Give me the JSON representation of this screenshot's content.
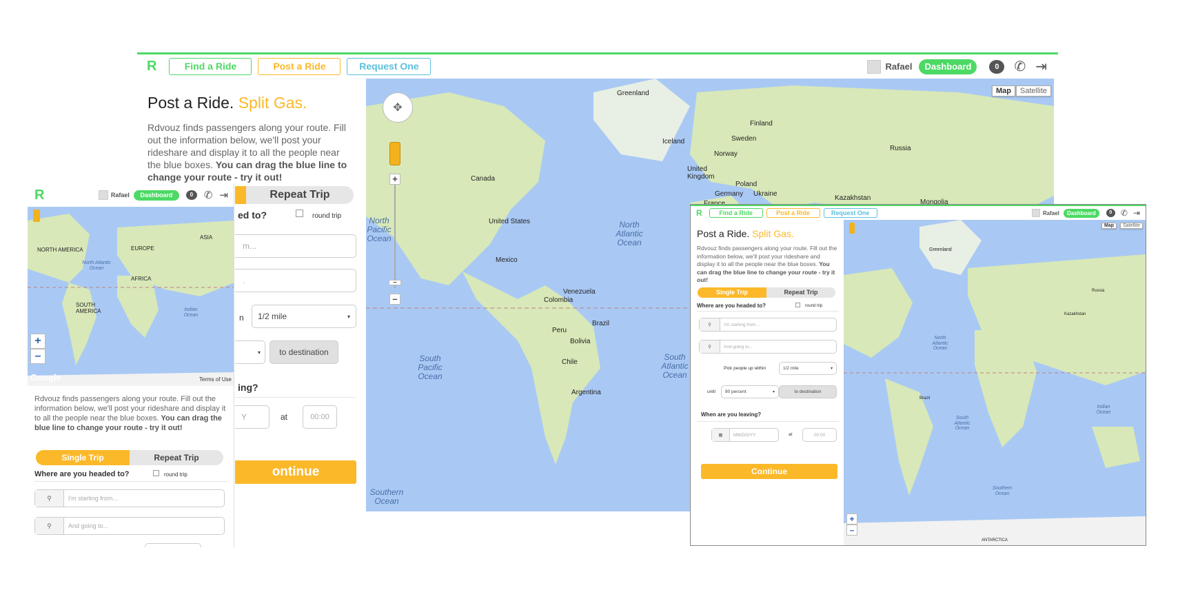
{
  "brand": {
    "logo": "R"
  },
  "nav": {
    "find_ride": "Find a Ride",
    "post_ride": "Post a Ride",
    "request_one": "Request One",
    "user_name": "Rafael",
    "dashboard": "Dashboard",
    "messages_count": "0"
  },
  "hero": {
    "title_main": "Post a Ride.",
    "title_accent": "Split Gas.",
    "description": "Rdvouz finds passengers along your route. Fill out the information below, we'll post your rideshare and display it to all the people near the blue boxes.",
    "description_bold": "You can drag the blue line to change your route - try it out!"
  },
  "trip_toggle": {
    "single": "Single Trip",
    "repeat": "Repeat Trip"
  },
  "form": {
    "headed_label": "Where are you headed to?",
    "round_trip": "round trip",
    "start_placeholder": "I'm starting from...",
    "dest_placeholder": "And going to...",
    "pickup_label": "Pick people up within",
    "pickup_value": "1/2 mile",
    "until_label": "until",
    "until_value": "80 percent",
    "to_destination": "to destination",
    "leaving_label": "When are you leaving?",
    "date_placeholder": "MM/DD/YY",
    "at_label": "at",
    "time_placeholder": "00:00",
    "continue": "Continue"
  },
  "map": {
    "type_map": "Map",
    "type_satellite": "Satellite",
    "google": "Google",
    "terms": "Terms of Use",
    "labels": {
      "greenland": "Greenland",
      "iceland": "Iceland",
      "finland": "Finland",
      "sweden": "Sweden",
      "norway": "Norway",
      "russia": "Russia",
      "uk": "United Kingdom",
      "poland": "Poland",
      "germany": "Germany",
      "ukraine": "Ukraine",
      "kazakhstan": "Kazakhstan",
      "mongolia": "Mongolia",
      "france": "France",
      "canada": "Canada",
      "us": "United States",
      "mexico": "Mexico",
      "venezuela": "Venezuela",
      "colombia": "Colombia",
      "peru": "Peru",
      "brazil": "Brazil",
      "bolivia": "Bolivia",
      "chile": "Chile",
      "argentina": "Argentina",
      "north_atlantic": "North Atlantic Ocean",
      "north_pacific": "North Pacific Ocean",
      "south_pacific": "South Pacific Ocean",
      "south_atlantic": "South Atlantic Ocean",
      "southern": "Southern Ocean",
      "indian": "Indian Ocean",
      "atlantic": "Atlantic Ocean",
      "north_america": "NORTH AMERICA",
      "south_america": "SOUTH AMERICA",
      "europe": "EUROPE",
      "africa": "AFRICA",
      "asia": "ASIA",
      "antarctica": "ANTARCTICA",
      "oceans_short": "North Atlantic Ocean"
    }
  },
  "colors": {
    "green": "#4cd964",
    "orange": "#fbb829",
    "blue": "#5bc0de",
    "water": "#a9c9f4",
    "land": "#d8e8b8"
  }
}
